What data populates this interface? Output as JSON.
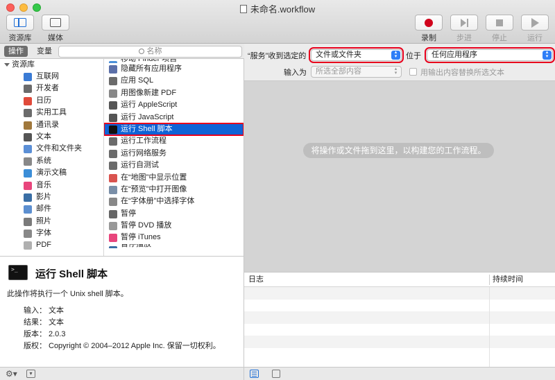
{
  "window": {
    "title": "未命名.workflow"
  },
  "toolbar": {
    "library": "资源库",
    "media": "媒体",
    "record": "录制",
    "step": "步进",
    "stop": "停止",
    "run": "运行"
  },
  "left_header": {
    "actions_tab": "操作",
    "variables_tab": "变量",
    "search_placeholder": "名称"
  },
  "library": {
    "root": "资源库",
    "items": [
      {
        "label": "互联网",
        "color": "#3a7bd5"
      },
      {
        "label": "开发者",
        "color": "#6b6b6b"
      },
      {
        "label": "日历",
        "color": "#e04a3a"
      },
      {
        "label": "实用工具",
        "color": "#6b6b6b"
      },
      {
        "label": "通讯录",
        "color": "#a0783c"
      },
      {
        "label": "文本",
        "color": "#555555"
      },
      {
        "label": "文件和文件夹",
        "color": "#5b8fd6"
      },
      {
        "label": "系统",
        "color": "#888888"
      },
      {
        "label": "演示文稿",
        "color": "#3b8ed8"
      },
      {
        "label": "音乐",
        "color": "#e8457c"
      },
      {
        "label": "影片",
        "color": "#3a6ea5"
      },
      {
        "label": "邮件",
        "color": "#5c8fd0"
      },
      {
        "label": "照片",
        "color": "#7a7a7a"
      },
      {
        "label": "字体",
        "color": "#888888"
      },
      {
        "label": "PDF",
        "color": "#b0b0b0"
      }
    ]
  },
  "actions": {
    "items": [
      {
        "label": "移动 Finder 项目",
        "color": "#4a90d9",
        "partial": true
      },
      {
        "label": "隐藏所有应用程序",
        "color": "#5b6fa8"
      },
      {
        "label": "应用 SQL",
        "color": "#6b6b6b"
      },
      {
        "label": "用图像新建 PDF",
        "color": "#888888"
      },
      {
        "label": "运行 AppleScript",
        "color": "#555555"
      },
      {
        "label": "运行 JavaScript",
        "color": "#555555"
      },
      {
        "label": "运行 Shell 脚本",
        "color": "#111111",
        "selected": true
      },
      {
        "label": "运行工作流程",
        "color": "#6b6b6b"
      },
      {
        "label": "运行网络服务",
        "color": "#6b6b6b"
      },
      {
        "label": "运行自测试",
        "color": "#6b6b6b"
      },
      {
        "label": "在“地图”中显示位置",
        "color": "#d9534f"
      },
      {
        "label": "在“预览”中打开图像",
        "color": "#7a8fa8"
      },
      {
        "label": "在“字体册”中选择字体",
        "color": "#888888"
      },
      {
        "label": "暂停",
        "color": "#666666"
      },
      {
        "label": "暂停 DVD 播放",
        "color": "#999999"
      },
      {
        "label": "暂停 iTunes",
        "color": "#e8457c"
      },
      {
        "label": "暂停播放",
        "color": "#3a6ea5",
        "partial": true
      }
    ]
  },
  "description": {
    "title": "运行 Shell 脚本",
    "text": "此操作将执行一个 Unix shell 脚本。",
    "rows": [
      {
        "key": "输入：",
        "value": "文本"
      },
      {
        "key": "结果：",
        "value": "文本"
      },
      {
        "key": "版本：",
        "value": "2.0.3"
      },
      {
        "key": "版权：",
        "value": "Copyright © 2004–2012 Apple Inc. 保留一切权利。"
      }
    ]
  },
  "workflow": {
    "service_receives_label": "“服务”收到选定的",
    "input_type_value": "文件或文件夹",
    "in_label": "位于",
    "application_value": "任何应用程序",
    "input_is_label": "输入为",
    "input_is_value": "所选全部内容",
    "replace_label": "用输出内容替换所选文本",
    "drop_hint": "将操作或文件拖到这里，以构建您的工作流程。"
  },
  "log": {
    "col_log": "日志",
    "col_duration": "持续时间"
  },
  "colors": {
    "selection": "#0f63d6",
    "highlight_outline": "#e8001c",
    "record": "#d0021b"
  }
}
